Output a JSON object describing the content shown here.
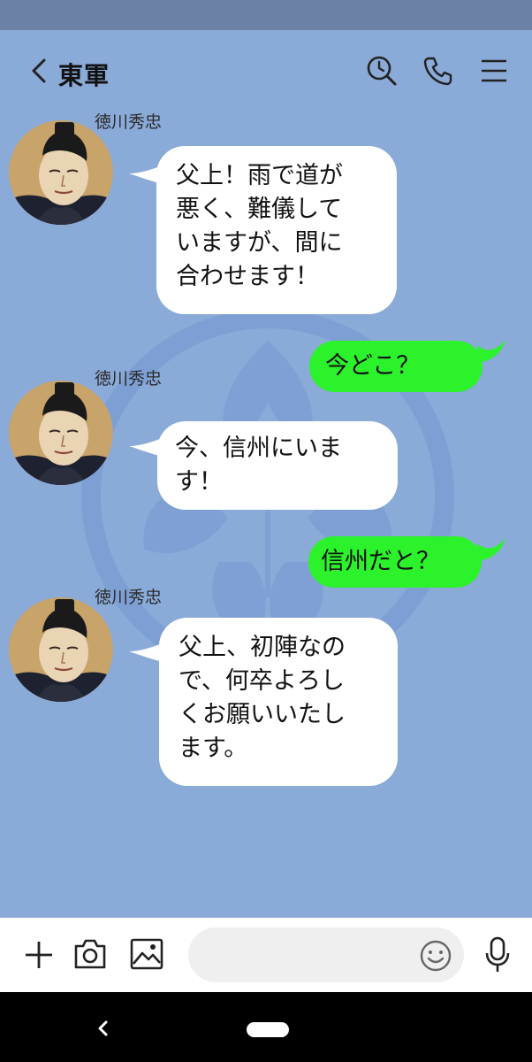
{
  "header": {
    "title": "東軍",
    "icons": [
      "back-chevron-icon",
      "history-search-icon",
      "phone-icon",
      "menu-icon"
    ]
  },
  "messages": [
    {
      "sender": "徳川秀忠",
      "side": "left",
      "lines": [
        "父上！雨で道が",
        "悪く、難儀して",
        "いますが、間に",
        "合わせます！"
      ]
    },
    {
      "sender": "",
      "side": "right",
      "lines": [
        "今どこ？"
      ]
    },
    {
      "sender": "徳川秀忠",
      "side": "left",
      "lines": [
        "今、信州にいま",
        "す！"
      ]
    },
    {
      "sender": "",
      "side": "right",
      "lines": [
        "信州だと？"
      ]
    },
    {
      "sender": "徳川秀忠",
      "side": "left",
      "lines": [
        "父上、初陣なの",
        "で、何卒よろし",
        "くお願いいたし",
        "ます。"
      ]
    }
  ],
  "input_bar": {
    "icons": [
      "plus-icon",
      "camera-icon",
      "image-icon",
      "emoji-icon",
      "microphone-icon"
    ],
    "placeholder": ""
  },
  "colors": {
    "chat_background": "#8aaad8",
    "status_bar": "#6b82a6",
    "outgoing_bubble": "#2cf22c",
    "incoming_bubble": "#ffffff"
  }
}
